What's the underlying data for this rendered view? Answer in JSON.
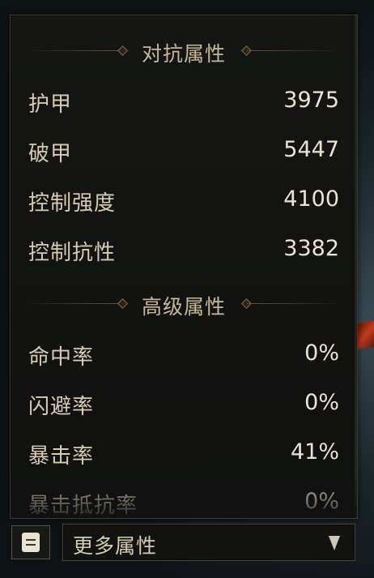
{
  "panel": {
    "sections": [
      {
        "title": "对抗属性",
        "rows": [
          {
            "label": "护甲",
            "value": "3975"
          },
          {
            "label": "破甲",
            "value": "5447"
          },
          {
            "label": "控制强度",
            "value": "4100"
          },
          {
            "label": "控制抗性",
            "value": "3382"
          }
        ]
      },
      {
        "title": "高级属性",
        "rows": [
          {
            "label": "命中率",
            "value": "0%"
          },
          {
            "label": "闪避率",
            "value": "0%"
          },
          {
            "label": "暴击率",
            "value": "41%"
          },
          {
            "label": "暴击抵抗率",
            "value": "0%"
          }
        ]
      }
    ]
  },
  "footer": {
    "icon": "scroll-icon",
    "dropdown_label": "更多属性",
    "dropdown_icon": "chevron-down-icon"
  },
  "colors": {
    "label": "#d8cbb2",
    "value": "#ece4d2",
    "section_title": "#c9b79a",
    "accent_line": "#6b5436"
  }
}
